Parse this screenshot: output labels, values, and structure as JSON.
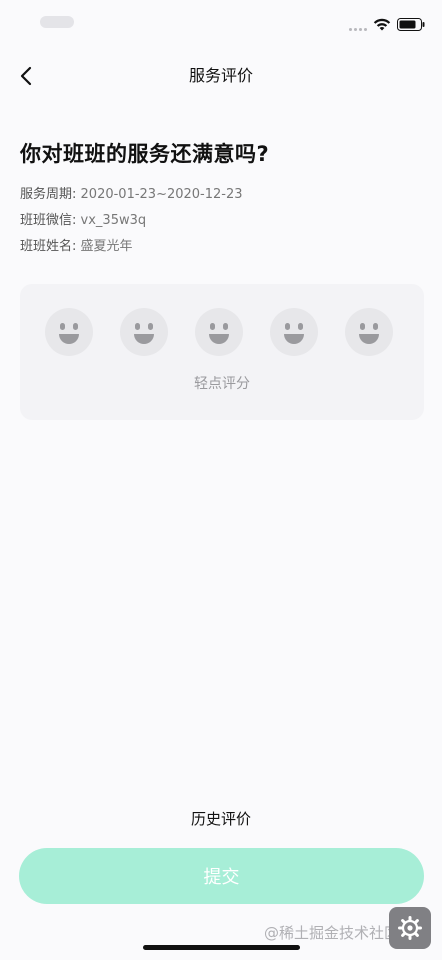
{
  "status_bar": {
    "icons": [
      "signal-dots-icon",
      "wifi-icon",
      "battery-icon"
    ]
  },
  "nav": {
    "back_icon": "chevron-left-icon",
    "title": "服务评价"
  },
  "question": "你对班班的服务还满意吗?",
  "info": {
    "period_label": "服务周期:",
    "period_value": "2020-01-23~2020-12-23",
    "wechat_label": "班班微信:",
    "wechat_value": "vx_35w3q",
    "name_label": "班班姓名:",
    "name_value": "盛夏光年"
  },
  "rating": {
    "faces": [
      "smiley-face-icon",
      "smiley-face-icon",
      "smiley-face-icon",
      "smiley-face-icon",
      "smiley-face-icon"
    ],
    "selected": 0,
    "max": 5,
    "hint": "轻点评分"
  },
  "history_label": "历史评价",
  "submit_label": "提交",
  "watermark": "@稀土掘金技术社区",
  "colors": {
    "background": "#fafafc",
    "card": "#f3f3f6",
    "submit": "#a7eed7",
    "face": "#e7e7ea"
  }
}
